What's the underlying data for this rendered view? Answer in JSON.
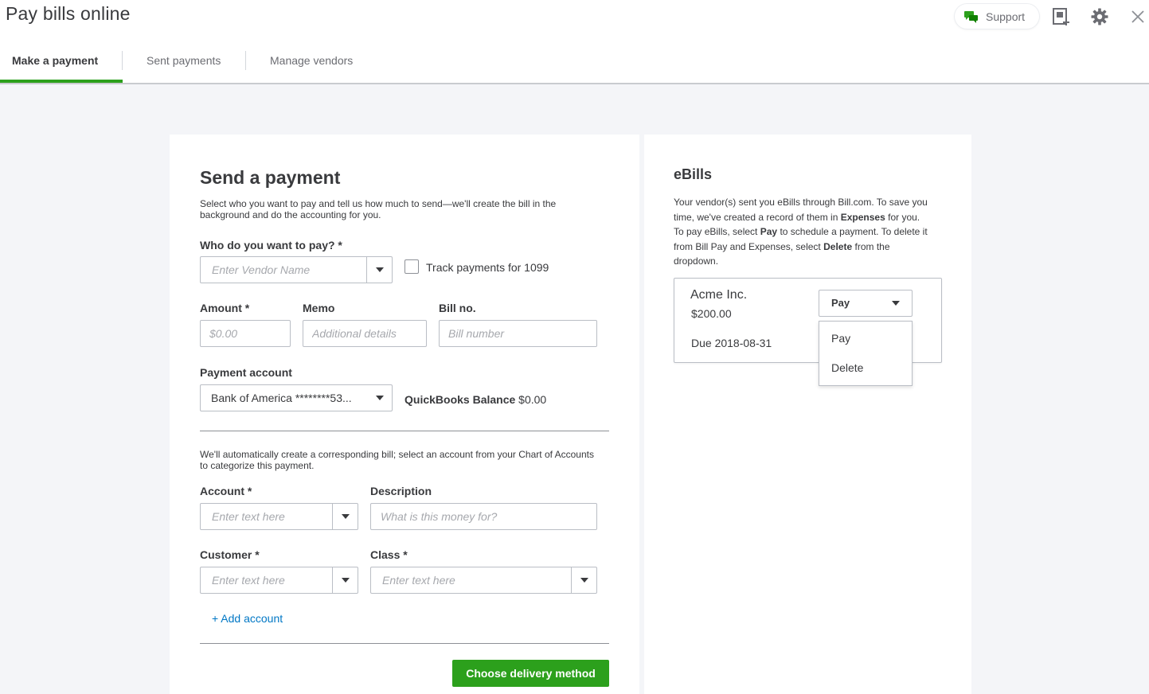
{
  "header": {
    "title": "Pay bills online",
    "support_label": "Support",
    "icons": [
      "chat-icon",
      "add-document-icon",
      "gear-icon",
      "close-icon"
    ],
    "accent_color": "#2ca01c"
  },
  "tabs": [
    {
      "label": "Make a payment",
      "active": true
    },
    {
      "label": "Sent payments",
      "active": false
    },
    {
      "label": "Manage vendors",
      "active": false
    }
  ],
  "payment_form": {
    "title": "Send a payment",
    "intro": "Select who you want to pay and tell us how much to send—we'll create the bill in the background and do the accounting for you.",
    "vendor_label": "Who do you want to pay? *",
    "vendor_placeholder": "Enter Vendor Name",
    "track_1099_label": "Track payments for 1099",
    "amount_label": "Amount *",
    "amount_placeholder": "$0.00",
    "memo_label": "Memo",
    "memo_placeholder": "Additional details",
    "bill_no_label": "Bill no.",
    "bill_no_placeholder": "Bill number",
    "payment_account_label": "Payment account",
    "payment_account_value": "Bank of America ********53...",
    "qb_balance_label": "QuickBooks Balance",
    "qb_balance_value": "$0.00",
    "chart_note": "We'll automatically create a corresponding bill; select an account from your Chart of Accounts to categorize this payment.",
    "account_label": "Account *",
    "account_placeholder": "Enter text here",
    "description_label": "Description",
    "description_placeholder": "What is this money for?",
    "customer_label": "Customer *",
    "customer_placeholder": "Enter text here",
    "class_label": "Class *",
    "class_placeholder": "Enter text here",
    "add_account_link": "+ Add account",
    "submit_label": "Choose delivery method"
  },
  "ebills": {
    "title": "eBills",
    "intro_lines": [
      "Your vendor(s) sent you eBills through Bill.com. To save you",
      "time, we've created a record of them in",
      "Expenses",
      "for you.",
      "To pay eBills, select",
      "Pay",
      "to schedule a payment. To delete it",
      "from Bill Pay and Expenses, select",
      "Delete",
      "from the",
      "dropdown."
    ],
    "bill": {
      "vendor": "Acme Inc.",
      "amount": "$200.00",
      "due": "Due 2018-08-31",
      "action_selected": "Pay",
      "action_options": [
        "Pay",
        "Delete"
      ]
    }
  }
}
